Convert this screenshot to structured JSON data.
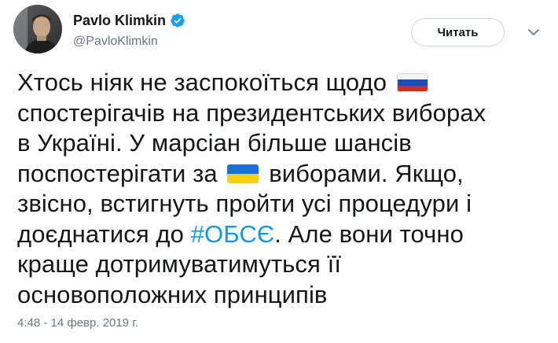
{
  "user": {
    "display_name": "Pavlo Klimkin",
    "handle": "@PavloKlimkin",
    "verified_icon": "verified-badge-icon",
    "avatar_icon": "avatar"
  },
  "follow_button": {
    "label": "Читать"
  },
  "menu": {
    "icon": "chevron-down-icon"
  },
  "tweet": {
    "line1_text": "Хтось ніяк не заспокоїться щодо",
    "line1_flag": "russia-flag-icon",
    "line2_text": "спостерігачів на президентських виборах",
    "line3_text": "в Україні. У марсіан більше шансів",
    "line4_before": "поспостерігати за",
    "line4_flag": "ukraine-flag-icon",
    "line4_after": "виборами. Якщо,",
    "line5_text": "звісно, встигнуть пройти усі процедури і",
    "line6_before": "доєднатися до",
    "line6_hashtag": "#ОБСЄ",
    "line6_after": ". Але вони точно",
    "line7_text": "краще дотримуватимуться її",
    "line8_text": "основоположних принципів"
  },
  "timestamp": "4:48 - 14 февр. 2019 г.",
  "colors": {
    "text": "#14171a",
    "secondary": "#657786",
    "link": "#1b95e0",
    "verified": "#1da1f2",
    "border": "#ccd6dd"
  }
}
